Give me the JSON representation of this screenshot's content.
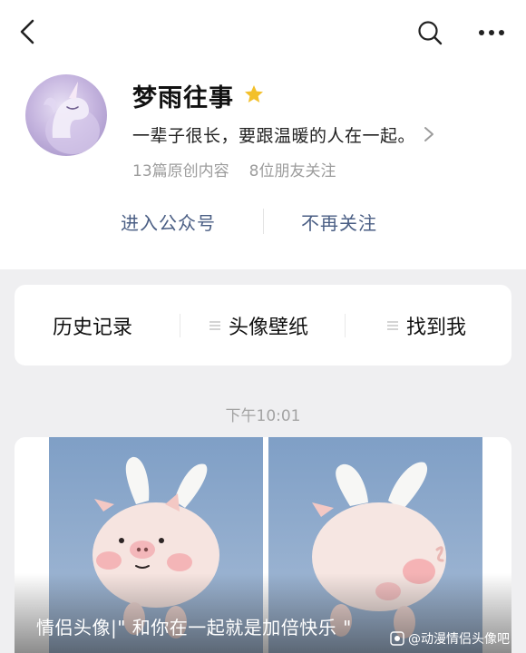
{
  "profile": {
    "name": "梦雨往事",
    "bio": "一辈子很长，要跟温暖的人在一起。",
    "stats": {
      "articles": "13篇原创内容",
      "friends_following": "8位朋友关注"
    }
  },
  "actions": {
    "enter_label": "进入公众号",
    "unfollow_label": "不再关注"
  },
  "menu": {
    "items": [
      {
        "label": "历史记录"
      },
      {
        "label": "头像壁纸"
      },
      {
        "label": "找到我"
      }
    ]
  },
  "feed": {
    "timestamp": "下午10:01",
    "article": {
      "title": "情侣头像|\" 和你在一起就是加倍快乐 \""
    }
  },
  "watermark": {
    "text": "@动漫情侣头像吧"
  },
  "icons": {
    "nav": [
      "back-icon",
      "search-icon",
      "more-icon"
    ],
    "badge": "star-icon"
  },
  "colors": {
    "link_text": "#4a5e84",
    "star": "#f3c02b",
    "page_background": "#efeff1",
    "muted_text": "#9c9c9c"
  }
}
